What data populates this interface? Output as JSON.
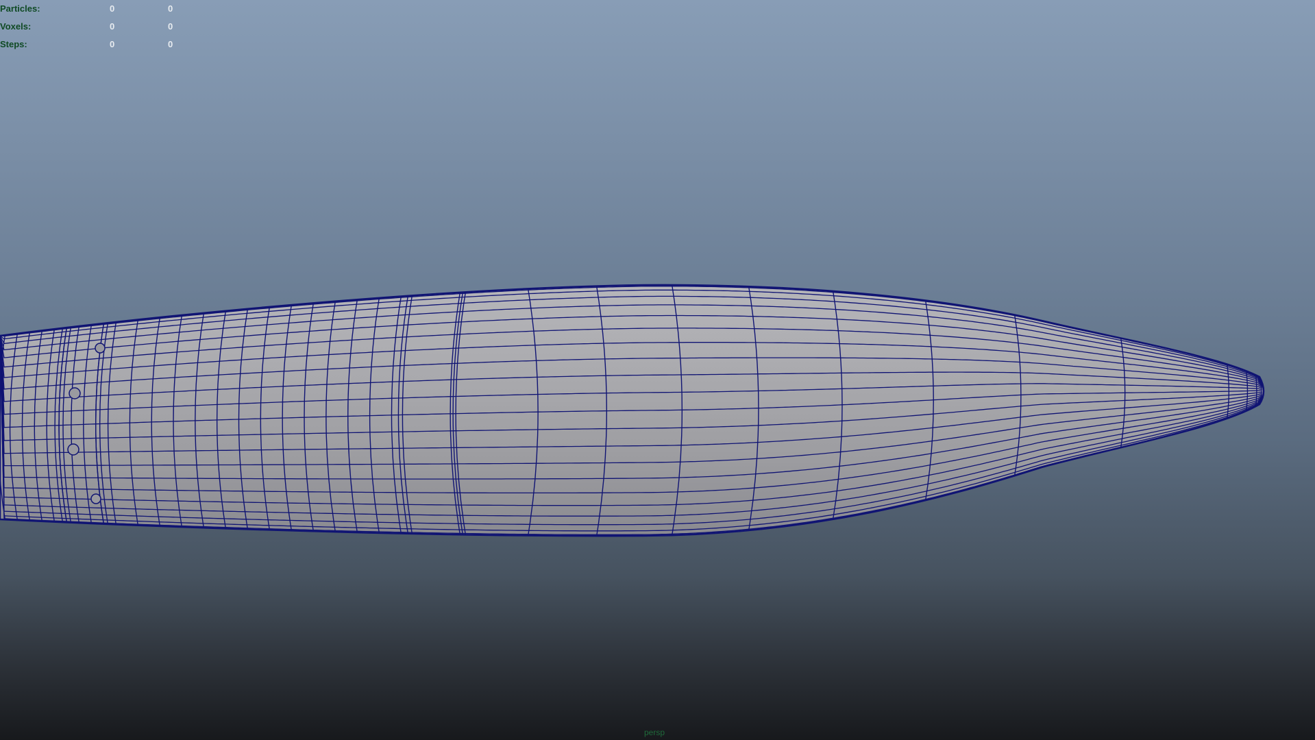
{
  "hud": {
    "rows": [
      {
        "label": "Particles:",
        "value_a": "0",
        "value_b": "0"
      },
      {
        "label": "Voxels:",
        "value_a": "0",
        "value_b": "0"
      },
      {
        "label": "Steps:",
        "value_a": "0",
        "value_b": "0"
      }
    ]
  },
  "viewport": {
    "camera_name": "persp",
    "shape": "wireframe-on-shaded cylindrical body with ogive nose",
    "background_top_color": "#889db6",
    "background_bottom_color": "#17191c",
    "surface_color": "#a3a3a8",
    "wire_color": "#101473"
  }
}
